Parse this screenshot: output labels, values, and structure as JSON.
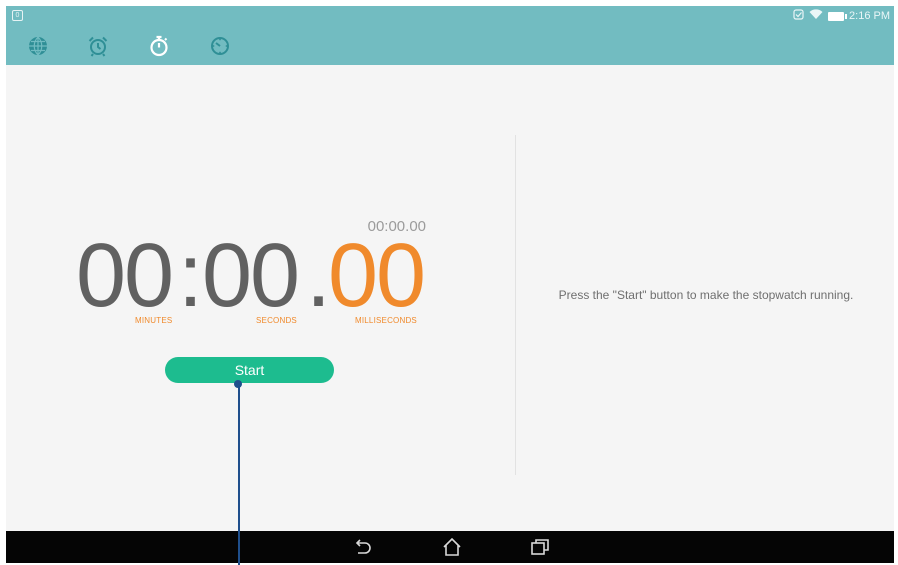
{
  "status_bar": {
    "left_icon": "notification-icon",
    "left_glyph": "0",
    "icons": [
      "alarm-status-icon",
      "wifi-icon",
      "battery-icon"
    ],
    "time": "2:16 PM"
  },
  "tabs": [
    {
      "name": "world-clock",
      "icon": "globe-icon"
    },
    {
      "name": "alarm",
      "icon": "alarm-clock-icon"
    },
    {
      "name": "stopwatch",
      "icon": "stopwatch-icon",
      "active": true
    },
    {
      "name": "timer",
      "icon": "timer-icon"
    }
  ],
  "stopwatch": {
    "lap_time": "00:00.00",
    "minutes": "00",
    "sep1": ":",
    "seconds": "00",
    "sep2": ".",
    "milliseconds": "00",
    "minutes_label": "MINUTES",
    "seconds_label": "SECONDS",
    "milliseconds_label": "MILLISECONDS",
    "start_label": "Start"
  },
  "hint": "Press the \"Start\" button to make the stopwatch running.",
  "nav_bar": {
    "icons": [
      "back-icon",
      "home-icon",
      "recent-apps-icon"
    ]
  },
  "colors": {
    "app_bar": "#72bcc1",
    "accent_orange": "#f08a2c",
    "start_button": "#1dbc8f",
    "digits": "#616161",
    "callout": "#1f4f8c"
  }
}
